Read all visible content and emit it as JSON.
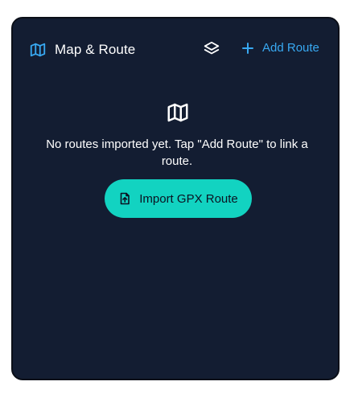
{
  "header": {
    "title": "Map & Route",
    "title_icon": "map-icon",
    "layers_icon": "layers-icon",
    "add_route_label": "Add Route",
    "add_route_icon": "plus-icon"
  },
  "empty_state": {
    "icon": "map-icon",
    "message": "No routes imported yet. Tap \"Add Route\" to link a route.",
    "import_button_label": "Import GPX Route",
    "import_button_icon": "file-upload-icon"
  },
  "colors": {
    "card_background": "#131d32",
    "accent_blue": "#38a9f2",
    "accent_teal": "#12d3c1",
    "text_primary": "#ffffff"
  }
}
